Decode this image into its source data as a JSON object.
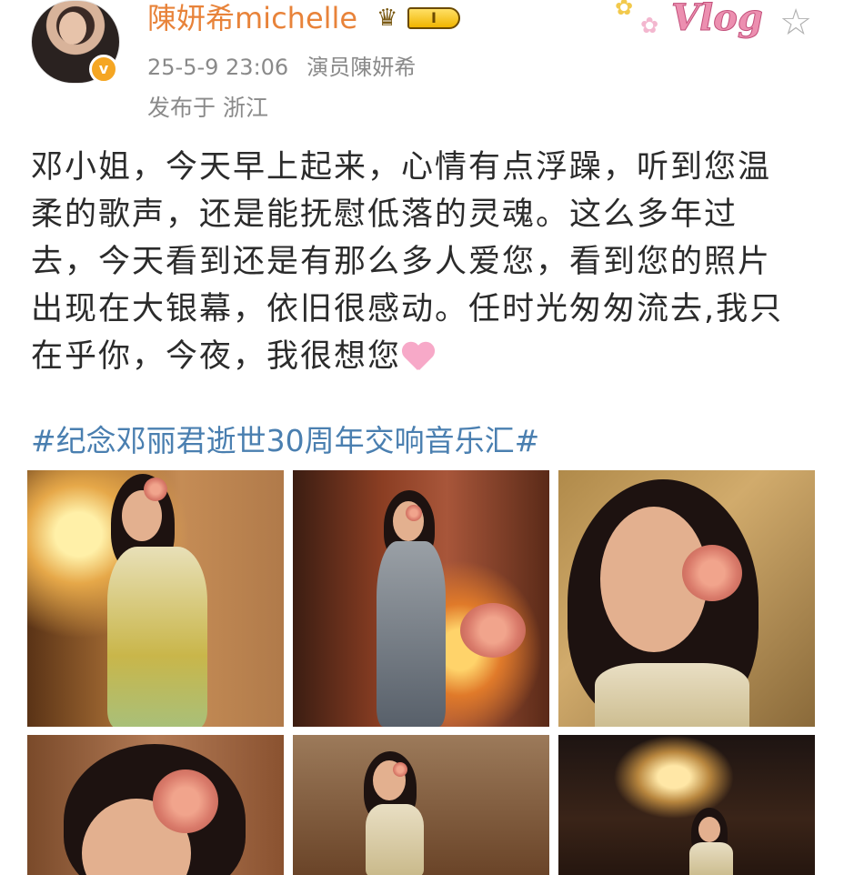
{
  "author": {
    "name": "陳妍希michelle",
    "vip_level": "I",
    "verified_mark": "v"
  },
  "post": {
    "timestamp": "25-5-9 23:06",
    "source": "演员陳妍希",
    "location": "发布于 浙江",
    "text_lines": [
      "邓小姐，今天早上起来，心情有点浮躁，听到您温",
      "柔的歌声，还是能抚慰低落的灵魂。这么多年过",
      "去，今天看到还是有那么多人爱您，看到您的照片",
      "出现在大银幕，依旧很感动。任时光匆匆流去,我只",
      "在乎你，今夜，我很想您"
    ],
    "hashtag": "#纪念邓丽君逝世30周年交响音乐汇#"
  },
  "decor": {
    "sticker_text": "Vlog",
    "flower_glyph": "✿",
    "star_glyph": "☆",
    "crown_glyph": "♛"
  },
  "photos": [
    {
      "name": "photo-1"
    },
    {
      "name": "photo-2"
    },
    {
      "name": "photo-3"
    },
    {
      "name": "photo-4"
    },
    {
      "name": "photo-5"
    },
    {
      "name": "photo-6"
    }
  ]
}
